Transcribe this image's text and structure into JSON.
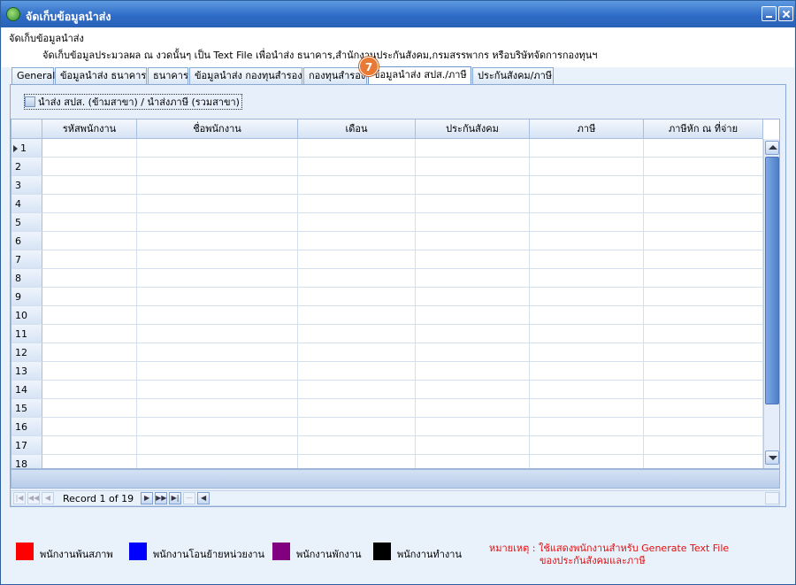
{
  "window": {
    "title": "จัดเก็บข้อมูลนำส่ง"
  },
  "header": {
    "title": "จัดเก็บข้อมูลนำส่ง",
    "description": "จัดเก็บข้อมูลประมวลผล ณ งวดนั้นๆ เป็น Text File เพื่อนำส่ง ธนาคาร,สำนักงานประกันสังคม,กรมสรรพากร หรือบริษัทจัดการกองทุนฯ"
  },
  "tabs": [
    {
      "label": "General",
      "active": false
    },
    {
      "label": "ข้อมูลนำส่ง ธนาคาร",
      "active": false
    },
    {
      "label": "ธนาคาร",
      "active": false
    },
    {
      "label": "ข้อมูลนำส่ง กองทุนสำรอง",
      "active": false
    },
    {
      "label": "กองทุนสำรอง",
      "active": false
    },
    {
      "label": "ข้อมูลนำส่ง สปส./ภาษี",
      "active": true
    },
    {
      "label": "ประกันสังคม/ภาษี",
      "active": false
    }
  ],
  "step_badge": "7",
  "checkbox": {
    "label": "นำส่ง สปส. (ข้ามสาขา) / นำส่งภาษี (รวมสาขา)",
    "checked": false
  },
  "grid": {
    "columns": [
      "รหัสพนักงาน",
      "ชื่อพนักงาน",
      "เดือน",
      "ประกันสังคม",
      "ภาษี",
      "ภาษีหัก ณ ที่จ่าย"
    ],
    "row_numbers": [
      "1",
      "2",
      "3",
      "4",
      "5",
      "6",
      "7",
      "8",
      "9",
      "10",
      "11",
      "12",
      "13",
      "14",
      "15",
      "16",
      "17",
      "18"
    ],
    "current_row": 1
  },
  "navigator": {
    "record_text": "Record 1 of 19"
  },
  "legend": [
    {
      "label": "พนักงานพ้นสภาพ",
      "color": "#ff0000"
    },
    {
      "label": "พนักงานโอนย้ายหน่วยงาน",
      "color": "#0000ff"
    },
    {
      "label": "พนักงานพักงาน",
      "color": "#800080"
    },
    {
      "label": "พนักงานทำงาน",
      "color": "#000000"
    }
  ],
  "note": {
    "line1": "หมายเหตุ : ใช้แสดงพนักงานสำหรับ Generate Text File",
    "line2": "ของประกันสังคมและภาษี",
    "color": "#e01010"
  }
}
